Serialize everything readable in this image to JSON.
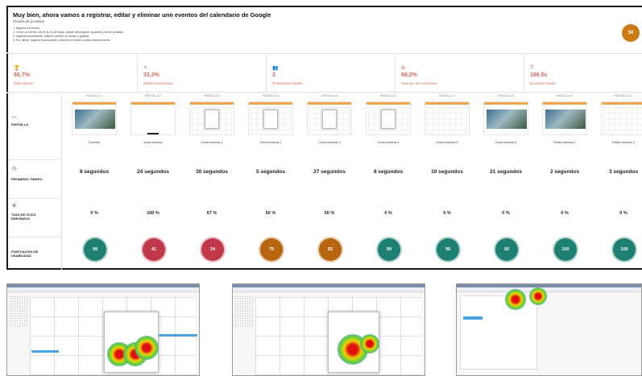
{
  "header": {
    "title": "Muy bien, ahora vamos a registrar, editar y eliminar unn eventos del calendario de Google",
    "subtitle": "Prueba de prototipo",
    "steps": [
      "1. Ingresa a Eventos",
      "2. Crear un evento, del fe al 21 de Mayo, añade descripción, guardar y cerrar pestaña",
      "3. Ingresa nuevamente, edita el nombre al evento y guarda",
      "4. Por último, ingresa nuevamente y elimina el evento creado anteriormente"
    ],
    "score": "50"
  },
  "metrics": [
    {
      "icon": "trophy-icon",
      "glyph": "🏆",
      "value": "66,7%",
      "label": "Éxito directo"
    },
    {
      "icon": "indirect-icon",
      "glyph": "↰",
      "value": "33,3%",
      "label": "Misión incorrectas"
    },
    {
      "icon": "users-icon",
      "glyph": "👥",
      "value": "3",
      "label": "Probadores totales"
    },
    {
      "icon": "click-icon",
      "glyph": "⊕",
      "value": "68,2%",
      "label": "Tasa de clics erróneos"
    },
    {
      "icon": "clock-icon",
      "glyph": "⏱",
      "value": "196.5s",
      "label": "Duración media"
    }
  ],
  "rows": {
    "pantalla": "PANTALLA",
    "promedio": "PROMEDIO TIEMPO",
    "tasa": "TASA DE CLICS ERRÓNEOS",
    "puntuacion": "PUNTUACIÓN DE USABILIDAD"
  },
  "columns": [
    {
      "header": "PANTALLA 1",
      "caption": "Eventos",
      "time": "8 segundos",
      "error": "0 %",
      "score": "99",
      "color": "#1e7f73",
      "kind": "photo"
    },
    {
      "header": "PANTALLA 2",
      "caption": "crear eventos",
      "time": "24 segundos",
      "error": "100 %",
      "score": "41",
      "color": "#c0394b",
      "kind": "blank"
    },
    {
      "header": "PANTALLA 3",
      "caption": "Crear eventos 1",
      "time": "30 segundos",
      "error": "67 %",
      "score": "24",
      "color": "#c0394b",
      "kind": "dialog"
    },
    {
      "header": "PANTALLA 4",
      "caption": "Crear eventos 2",
      "time": "5 segundos",
      "error": "50 %",
      "score": "75",
      "color": "#b8650f",
      "kind": "dialog"
    },
    {
      "header": "PANTALLA 5",
      "caption": "Crear eventos 3",
      "time": "27 segundos",
      "error": "50 %",
      "score": "65",
      "color": "#b8650f",
      "kind": "dialog"
    },
    {
      "header": "PANTALLA 6",
      "caption": "Crear eventos 4",
      "time": "8 segundos",
      "error": "0 %",
      "score": "99",
      "color": "#1e7f73",
      "kind": "dialog"
    },
    {
      "header": "PANTALLA 7",
      "caption": "Crear eventos 5",
      "time": "10 segundos",
      "error": "0 %",
      "score": "98",
      "color": "#1e7f73",
      "kind": "grid"
    },
    {
      "header": "PANTALLA 8",
      "caption": "Crear eventos 6",
      "time": "21 segundos",
      "error": "0 %",
      "score": "92",
      "color": "#1e7f73",
      "kind": "photo"
    },
    {
      "header": "PANTALLA 9",
      "caption": "Editar eventos 1",
      "time": "2 segundos",
      "error": "0 %",
      "score": "100",
      "color": "#1e7f73",
      "kind": "photo"
    },
    {
      "header": "PANTALLA 10",
      "caption": "Editar eventos 2",
      "time": "3 segundos",
      "error": "0 %",
      "score": "100",
      "color": "#1e7f73",
      "kind": "grid"
    }
  ],
  "heatmaps": {
    "count": 3
  }
}
